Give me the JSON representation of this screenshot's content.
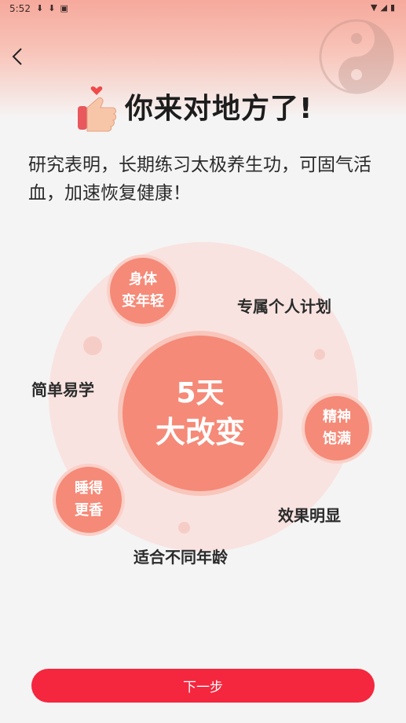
{
  "status_bar": {
    "time": "5:52",
    "left_icons": [
      "download-icon",
      "download-icon",
      "notification-icon"
    ],
    "right_icons": [
      "wifi-icon",
      "signal-icon",
      "battery-icon"
    ]
  },
  "header": {
    "back_icon": "chevron-left-icon",
    "decor_icon": "yin-yang-icon",
    "thumb_icon": "thumbs-up-heart-icon",
    "title": "你来对地方了!"
  },
  "intro": {
    "text": "研究表明，长期练习太极养生功，可固气活血，加速恢复健康！"
  },
  "diagram": {
    "center": {
      "line1": "5天",
      "line2": "大改变"
    },
    "bubbles": [
      {
        "line1": "身体",
        "line2": "变年轻"
      },
      {
        "line1": "精神",
        "line2": "饱满"
      },
      {
        "line1": "睡得",
        "line2": "更香"
      }
    ],
    "labels": [
      "专属个人计划",
      "简单易学",
      "效果明显",
      "适合不同年龄"
    ]
  },
  "footer": {
    "next_label": "下一步"
  },
  "colors": {
    "accent": "#f4273e",
    "bubble": "#f58a78",
    "bubble_light": "#fbd0c8",
    "background": "#f5f4f4"
  }
}
